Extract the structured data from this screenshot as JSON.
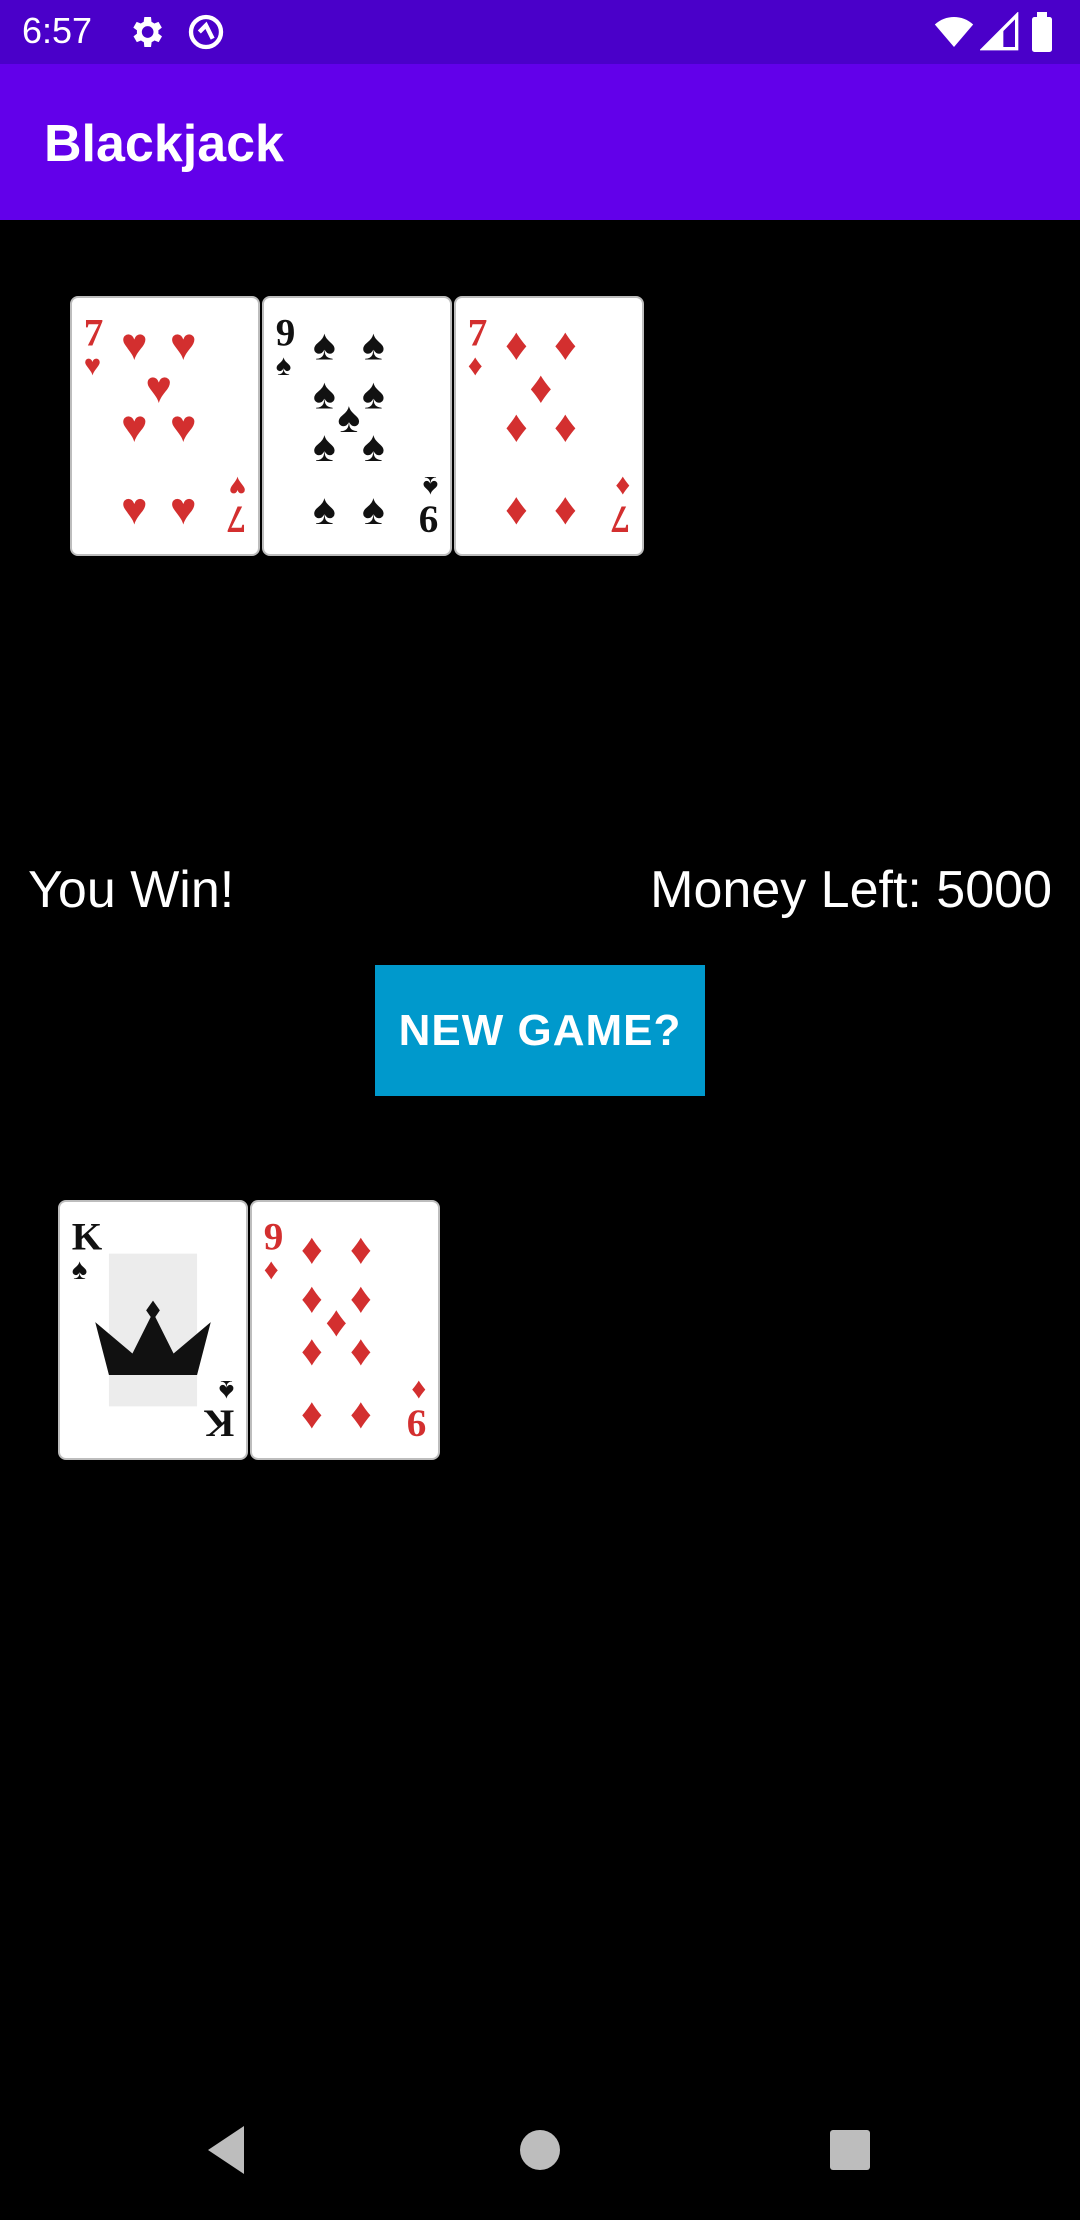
{
  "status_bar": {
    "time": "6:57",
    "left_icons": [
      "gear-icon",
      "at-sign-icon"
    ],
    "right_icons": [
      "wifi-icon",
      "signal-icon",
      "battery-icon"
    ]
  },
  "app_bar": {
    "title": "Blackjack"
  },
  "dealer_hand": [
    {
      "rank": "7",
      "suit": "hearts",
      "color": "#d32f2f"
    },
    {
      "rank": "9",
      "suit": "spades",
      "color": "#111111"
    },
    {
      "rank": "7",
      "suit": "diamonds",
      "color": "#d32f2f"
    }
  ],
  "player_hand": [
    {
      "rank": "K",
      "suit": "spades",
      "color": "#111111"
    },
    {
      "rank": "9",
      "suit": "diamonds",
      "color": "#d32f2f"
    }
  ],
  "result_text": "You Win!",
  "money_text": "Money Left: 5000",
  "new_game_button": {
    "label": "NEW GAME?",
    "color": "#0099cc"
  },
  "colors": {
    "status_bar": "#4a00c9",
    "app_bar": "#6200ea",
    "background": "#000000"
  },
  "nav_bar": {
    "icons": [
      "back-icon",
      "home-icon",
      "recents-icon"
    ]
  }
}
